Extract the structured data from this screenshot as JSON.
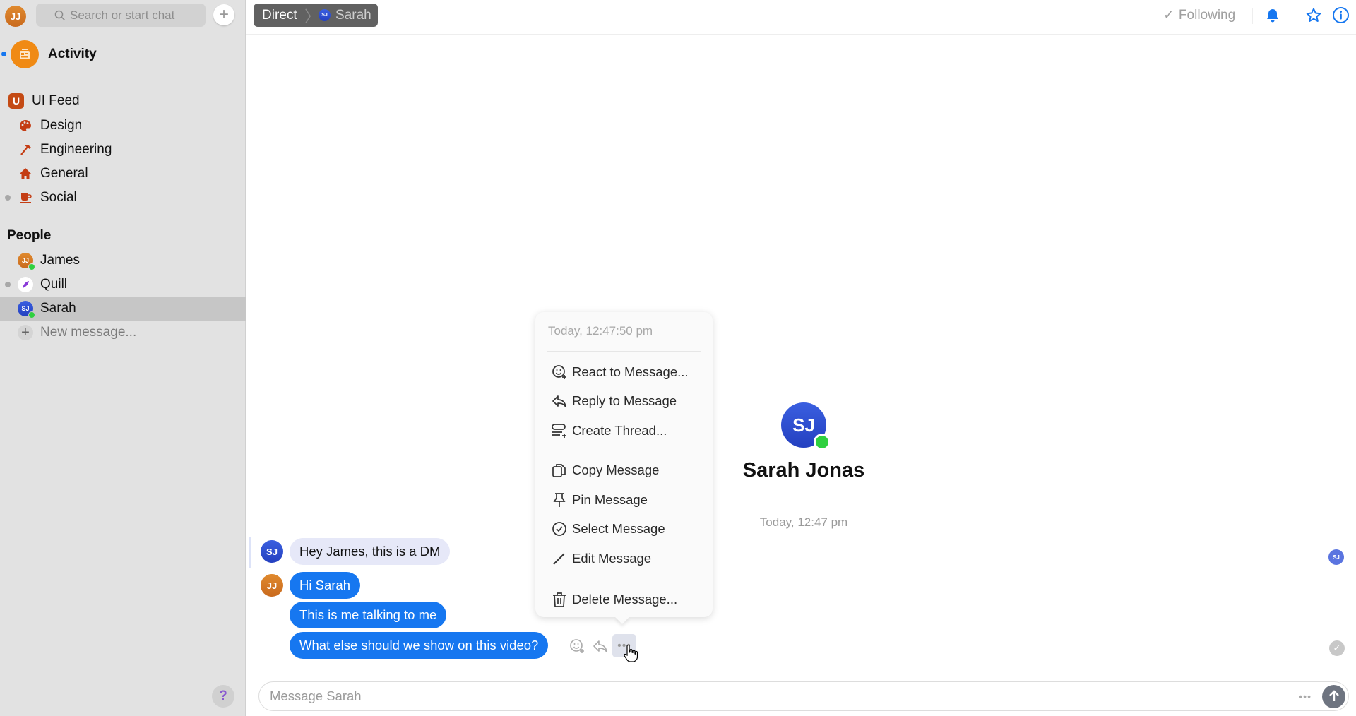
{
  "sidebar": {
    "user_initials": "JJ",
    "search_placeholder": "Search or start chat",
    "activity_label": "Activity",
    "workspace": {
      "badge": "U",
      "name": "UI Feed"
    },
    "channels": [
      {
        "label": "Design",
        "icon": "palette-icon"
      },
      {
        "label": "Engineering",
        "icon": "hammer-icon"
      },
      {
        "label": "General",
        "icon": "house-icon"
      },
      {
        "label": "Social",
        "icon": "coffee-cup-icon"
      }
    ],
    "people_header": "People",
    "people": [
      {
        "label": "James",
        "initials": "JJ",
        "online": true
      },
      {
        "label": "Quill",
        "initials": "",
        "online": false
      },
      {
        "label": "Sarah",
        "initials": "SJ",
        "online": true,
        "selected": true
      }
    ],
    "new_message": "New message...",
    "help": "?"
  },
  "header": {
    "breadcrumb_root": "Direct",
    "breadcrumb_initials": "SJ",
    "breadcrumb_current": "Sarah",
    "following_label": "Following"
  },
  "profile": {
    "initials": "SJ",
    "name": "Sarah Jonas",
    "timestamp": "Today, 12:47 pm"
  },
  "messages": [
    {
      "sender": "SJ",
      "text": "Hey James, this is a DM"
    },
    {
      "sender": "JJ",
      "text": "Hi Sarah"
    },
    {
      "sender": "JJ",
      "text": "This is me talking to me"
    },
    {
      "sender": "JJ",
      "text": "What else should we show on this video?"
    }
  ],
  "read_receipt_initials": "SJ",
  "context_menu": {
    "timestamp": "Today, 12:47:50 pm",
    "items": [
      "React to Message...",
      "Reply to Message",
      "Create Thread...",
      "Copy Message",
      "Pin Message",
      "Select Message",
      "Edit Message",
      "Delete Message..."
    ]
  },
  "composer": {
    "placeholder": "Message Sarah"
  },
  "colors": {
    "accent": "#1677f0",
    "online": "#2fd03f",
    "sidebar_bg": "#e2e2e2"
  }
}
